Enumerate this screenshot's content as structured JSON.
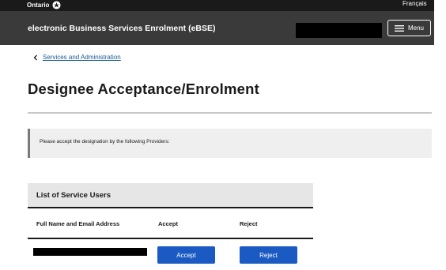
{
  "header": {
    "brand": "Ontario",
    "language_link": "Français",
    "app_title": "electronic Business Services Enrolment (eBSE)",
    "menu_label": "Menu"
  },
  "breadcrumb": {
    "label": "Services and Administration"
  },
  "page": {
    "title": "Designee Acceptance/Enrolment",
    "notice": "Please accept the designation by the following Providers:"
  },
  "table": {
    "title": "List of Service Users",
    "columns": [
      "Full Name and Email Address",
      "Accept",
      "Reject"
    ],
    "rows": [
      {
        "name": "",
        "accept_label": "Accept",
        "reject_label": "Reject"
      }
    ]
  },
  "colors": {
    "topbar": "#1a1a1a",
    "appbar": "#3a3a3a",
    "link": "#1a5a96",
    "button": "#1a5ac2"
  },
  "icons": [
    "trillium-icon",
    "menu-icon",
    "chevron-left-icon"
  ]
}
